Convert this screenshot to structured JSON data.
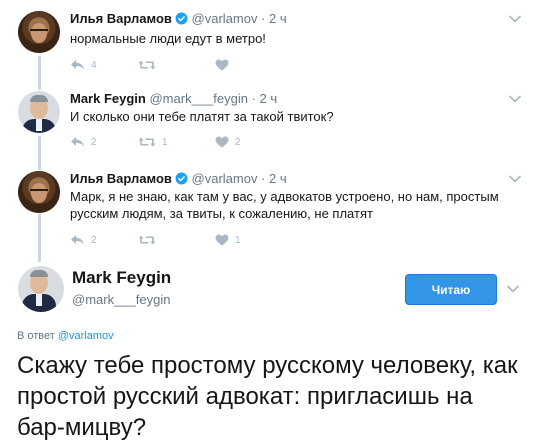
{
  "colors": {
    "link": "#1b95e0",
    "verified": "#1da1f2",
    "follow_button": "#3395e8",
    "muted": "#657786",
    "action_icon": "#aab8c2"
  },
  "tweets": [
    {
      "name": "Илья Варламов",
      "verified": true,
      "handle": "@varlamov",
      "time": "· 2 ч",
      "text": "нормальные люди едут в метро!",
      "replies": "4",
      "retweets": "",
      "likes": ""
    },
    {
      "name": "Mark Feygin",
      "verified": false,
      "handle": "@mark___feygin",
      "time": "· 2 ч",
      "text": "И сколько они тебе платят за такой твиток?",
      "replies": "2",
      "retweets": "1",
      "likes": "2"
    },
    {
      "name": "Илья Варламов",
      "verified": true,
      "handle": "@varlamov",
      "time": "· 2 ч",
      "text": "Марк, я не знаю, как там у вас, у адвокатов устроено, но нам, простым русским людям, за твиты, к сожалению, не платят",
      "replies": "2",
      "retweets": "",
      "likes": "1"
    }
  ],
  "main_tweet": {
    "name": "Mark Feygin",
    "handle": "@mark___feygin",
    "follow_label": "Читаю",
    "reply_prefix": "В ответ ",
    "reply_handle": "@varlamov",
    "text": "Скажу тебе простому русскому человеку, как простой русский адвокат: пригласишь на бар-мицву?"
  }
}
